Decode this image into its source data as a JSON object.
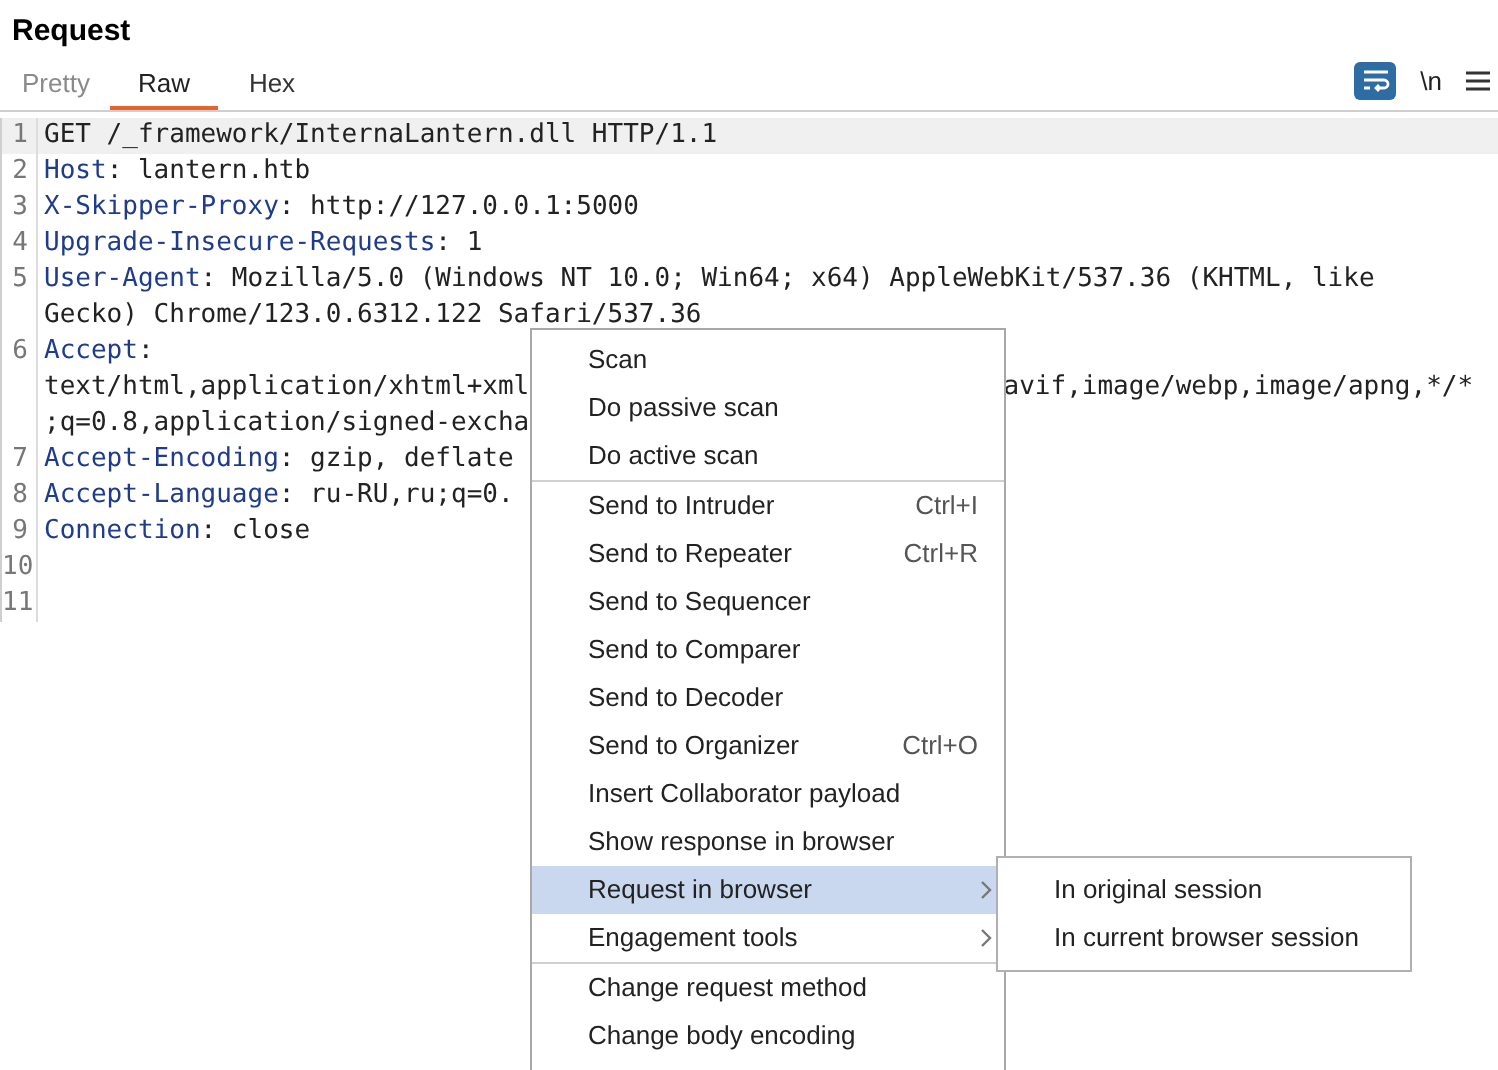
{
  "panel": {
    "title": "Request"
  },
  "tabs": [
    {
      "label": "Pretty",
      "selected": false
    },
    {
      "label": "Raw",
      "selected": true
    },
    {
      "label": "Hex",
      "selected": false
    }
  ],
  "toolbar": {
    "wrap_selected": true,
    "newline_label": "\\n"
  },
  "editor": {
    "lines": [
      {
        "number": "1",
        "current": true,
        "rows": [
          {
            "text": "GET /_framework/InternaLantern.dll HTTP/1.1"
          }
        ]
      },
      {
        "number": "2",
        "current": false,
        "rows": [
          {
            "header": "Host",
            "text": ": lantern.htb"
          }
        ]
      },
      {
        "number": "3",
        "current": false,
        "rows": [
          {
            "header": "X-Skipper-Proxy",
            "text": ": http://127.0.0.1:5000"
          }
        ]
      },
      {
        "number": "4",
        "current": false,
        "rows": [
          {
            "header": "Upgrade-Insecure-Requests",
            "text": ": 1"
          }
        ]
      },
      {
        "number": "5",
        "current": false,
        "rows": [
          {
            "header": "User-Agent",
            "text": ": Mozilla/5.0 (Windows NT 10.0; Win64; x64) AppleWebKit/537.36 (KHTML, like"
          },
          {
            "text": "Gecko) Chrome/123.0.6312.122 Safari/537.36"
          }
        ]
      },
      {
        "number": "6",
        "current": false,
        "rows": [
          {
            "header": "Accept",
            "text": ":"
          },
          {
            "text": "text/html,application/xhtml+xml",
            "after_menu": "avif,image/webp,image/apng,*/*"
          },
          {
            "text": ";q=0.8,application/signed-excha"
          }
        ]
      },
      {
        "number": "7",
        "current": false,
        "rows": [
          {
            "header": "Accept-Encoding",
            "text": ": gzip, deflate"
          }
        ]
      },
      {
        "number": "8",
        "current": false,
        "rows": [
          {
            "header": "Accept-Language",
            "text": ": ru-RU,ru;q=0."
          }
        ]
      },
      {
        "number": "9",
        "current": false,
        "rows": [
          {
            "header": "Connection",
            "text": ": close"
          }
        ]
      },
      {
        "number": "10",
        "current": false
      },
      {
        "number": "11",
        "current": false
      }
    ]
  },
  "context_menu": {
    "items": [
      {
        "kind": "item",
        "label": "Scan",
        "selected": false
      },
      {
        "kind": "item",
        "label": "Do passive scan",
        "selected": false
      },
      {
        "kind": "item",
        "label": "Do active scan",
        "selected": false
      },
      {
        "kind": "separator"
      },
      {
        "kind": "item",
        "label": "Send to Intruder",
        "shortcut": "Ctrl+I",
        "selected": false
      },
      {
        "kind": "item",
        "label": "Send to Repeater",
        "shortcut": "Ctrl+R",
        "selected": false
      },
      {
        "kind": "item",
        "label": "Send to Sequencer",
        "selected": false
      },
      {
        "kind": "item",
        "label": "Send to Comparer",
        "selected": false
      },
      {
        "kind": "item",
        "label": "Send to Decoder",
        "selected": false
      },
      {
        "kind": "item",
        "label": "Send to Organizer",
        "shortcut": "Ctrl+O",
        "selected": false
      },
      {
        "kind": "item",
        "label": "Insert Collaborator payload",
        "selected": false
      },
      {
        "kind": "item",
        "label": "Show response in browser",
        "selected": false
      },
      {
        "kind": "submenu",
        "label": "Request in browser",
        "selected": true
      },
      {
        "kind": "submenu",
        "label": "Engagement tools",
        "selected": false
      },
      {
        "kind": "separator"
      },
      {
        "kind": "item",
        "label": "Change request method",
        "selected": false
      },
      {
        "kind": "item",
        "label": "Change body encoding",
        "selected": false
      }
    ]
  },
  "submenu": {
    "items": [
      {
        "label": "In original session",
        "selected": false
      },
      {
        "label": "In current browser session",
        "selected": false
      }
    ]
  }
}
